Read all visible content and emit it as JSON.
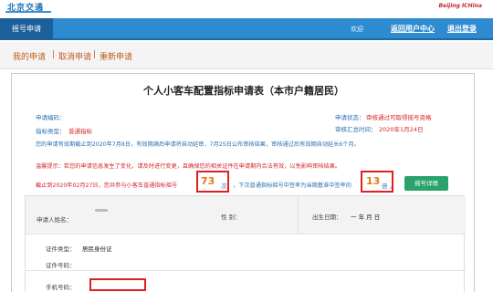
{
  "header": {
    "brand": "北京交通",
    "right_logo": "Beijing ICHina"
  },
  "nav": {
    "tab": "摇号申请",
    "welcome": "欢迎",
    "user_center": "返回用户中心",
    "logout": "退出登录"
  },
  "actions": {
    "my_application": "我的申请",
    "cancel_application": "取消申请",
    "reapply": "重新申请",
    "separator": "|"
  },
  "form": {
    "title": "个人小客车配置指标申请表（本市户籍居民）",
    "application_code_label": "申请编码：",
    "indicator_type_label": "指标类型：",
    "indicator_type_value": "普通指标",
    "status_label": "申请状态：",
    "status_value": "审核通过可取得摇号资格",
    "feedback_label": "审核汇总时间：",
    "feedback_value": "2020年1月24日",
    "validity_note": "您的申请有效期截止到2020年7月8日，有效期满后申请将自动延审，7月25日公布审核结果，审核通过后有效期自动延长6个月。",
    "reminder_note": "温馨提示：若您的申请信息发生了变化，请及时进行变更，且确保您的相关证件在申请期内合法有效，以免影响审核结果。",
    "count_prefix": "截止到2020年02月27日，您共参与小客车普通指标摇号",
    "attempts_value": "73",
    "attempts_unit": "次",
    "count_middle": "，下次普通指标摇号中签率为当期基准中签率的",
    "multiplier_value": "13",
    "multiplier_unit": "倍",
    "count_suffix": "。",
    "detail_button": "摇号详情"
  },
  "applicant": {
    "name_label": "申请人姓名：",
    "gender_label": "性 别：",
    "birth_label": "出生日期：",
    "birth_value": "一 年  月  日",
    "id_type_label": "证件类型：",
    "id_type_value": "居民身份证",
    "id_number_label": "证件号码：",
    "phone_label": "手机号码："
  }
}
